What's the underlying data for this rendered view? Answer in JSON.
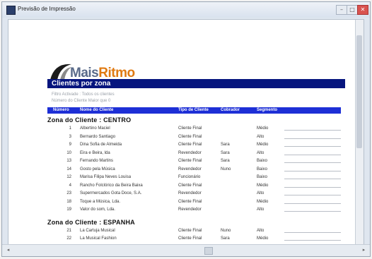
{
  "window": {
    "title": "Previsão de Impressão",
    "controls": [
      "–",
      "□",
      "✕"
    ]
  },
  "report": {
    "logo": {
      "part1": "Mais",
      "part2": "Ritmo"
    },
    "title": "Clientes por zona",
    "filters": [
      "Filtro Activade : Todos os clientes",
      "Número do Cliente Maior que 0"
    ],
    "columns": [
      "Número",
      "Nome do Cliente",
      "Tipo de Cliente",
      "Cobrador",
      "Segmento"
    ]
  },
  "zones": [
    {
      "label": "Zona do Cliente : CENTRO",
      "rows": [
        {
          "num": "1",
          "name": "Albertino Maciel",
          "type": "Cliente Final",
          "collector": "",
          "segment": "Médio"
        },
        {
          "num": "3",
          "name": "Bernardo Santiago",
          "type": "Cliente Final",
          "collector": "",
          "segment": "Alto"
        },
        {
          "num": "9",
          "name": "Dina Sofia de Almeida",
          "type": "Cliente Final",
          "collector": "Sara",
          "segment": "Médio"
        },
        {
          "num": "10",
          "name": "Eira e Beira, lda",
          "type": "Revendedor",
          "collector": "Sara",
          "segment": "Alto"
        },
        {
          "num": "13",
          "name": "Fernando Martins",
          "type": "Cliente Final",
          "collector": "Sara",
          "segment": "Baixo"
        },
        {
          "num": "14",
          "name": "Gosto pela Música",
          "type": "Revendedor",
          "collector": "Nuno",
          "segment": "Baixo"
        },
        {
          "num": "12",
          "name": "Marisa Filipa Neves Louisa",
          "type": "Funcionário",
          "collector": "",
          "segment": "Baixo"
        },
        {
          "num": "4",
          "name": "Rancho Folclórico da Beira Baixa",
          "type": "Cliente Final",
          "collector": "",
          "segment": "Médio"
        },
        {
          "num": "23",
          "name": "Supermercados Gota Doce, S.A.",
          "type": "Revendedor",
          "collector": "",
          "segment": "Alto"
        },
        {
          "num": "18",
          "name": "Toque a Música, Lda.",
          "type": "Cliente Final",
          "collector": "",
          "segment": "Médio"
        },
        {
          "num": "19",
          "name": "Valor do som, Lda.",
          "type": "Revendedor",
          "collector": "",
          "segment": "Alto"
        }
      ]
    },
    {
      "label": "Zona do Cliente : ESPANHA",
      "rows": [
        {
          "num": "21",
          "name": "La Cartuja Musical",
          "type": "Cliente Final",
          "collector": "Nuno",
          "segment": "Alto"
        },
        {
          "num": "22",
          "name": "La Musical Fashion",
          "type": "Cliente Final",
          "collector": "Sara",
          "segment": "Médio"
        }
      ]
    }
  ],
  "colors": {
    "titleBar": "#06157e",
    "headerBar": "#1d2fd6",
    "logoOrange": "#e07a12"
  }
}
